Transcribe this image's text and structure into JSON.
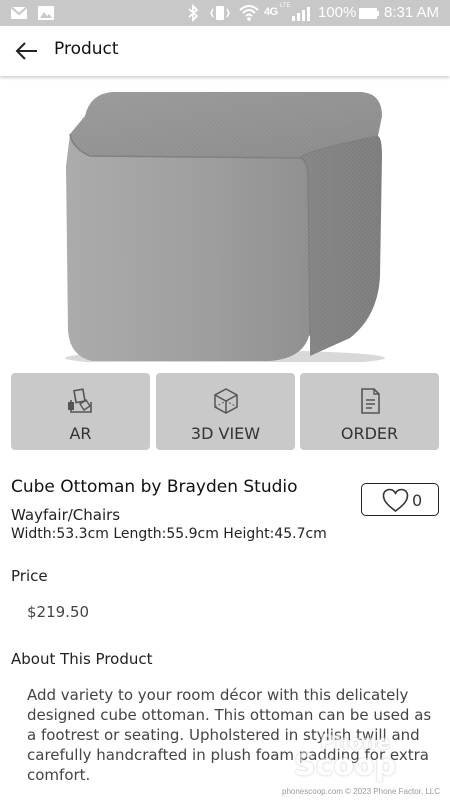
{
  "status_bar": {
    "network": "4G",
    "network_sup": "LTE",
    "battery": "100%",
    "time": "8:31 AM"
  },
  "app_bar": {
    "title": "Product"
  },
  "actions": [
    {
      "label": "AR",
      "icon": "ar-icon"
    },
    {
      "label": "3D VIEW",
      "icon": "cube-icon"
    },
    {
      "label": "ORDER",
      "icon": "document-icon"
    }
  ],
  "product": {
    "name": "Cube Ottoman by Brayden Studio",
    "category": "Wayfair/Chairs",
    "dimensions": "Width:53.3cm Length:55.9cm Height:45.7cm",
    "likes": "0",
    "price_label": "Price",
    "price": "$219.50",
    "about_label": "About This Product",
    "about_text": "Add variety to your room décor with this delicately designed cube ottoman. This ottoman can be used as a footrest or seating. Upholstered in stylish twill and carefully handcrafted in plush foam padding for extra comfort."
  },
  "watermark": {
    "line1": "Phone",
    "line2": "Scoop",
    "footer": "phonescoop.com  © 2023 Phone Factor, LLC"
  }
}
